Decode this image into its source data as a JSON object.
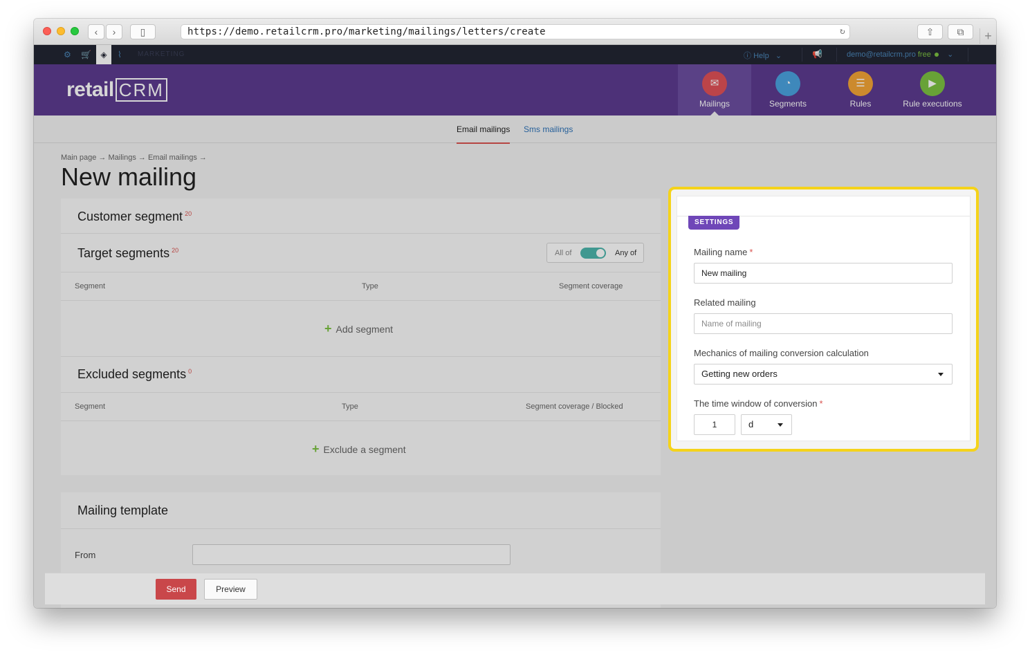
{
  "browser": {
    "url": "https://demo.retailcrm.pro/marketing/mailings/letters/create"
  },
  "topbar": {
    "section_label": "MARKETING",
    "help_label": "Help",
    "user_email": "demo@retailcrm.pro",
    "plan": "free"
  },
  "header": {
    "logo_text": "retail",
    "logo_crm": "CRM",
    "nav": [
      {
        "label": "Mailings",
        "icon": "mail-icon",
        "color": "#e05257",
        "active": true
      },
      {
        "label": "Segments",
        "icon": "segments-icon",
        "color": "#4aa3df"
      },
      {
        "label": "Rules",
        "icon": "rules-icon",
        "color": "#f3a536"
      },
      {
        "label": "Rule executions",
        "icon": "play-icon",
        "color": "#7dc242"
      }
    ]
  },
  "subtabs": {
    "email": "Email mailings",
    "sms": "Sms mailings"
  },
  "breadcrumb": "Main page → Mailings → Email mailings →",
  "page_title": "New mailing",
  "customer_segment": {
    "title": "Customer segment",
    "count": "20"
  },
  "target_segments": {
    "title": "Target segments",
    "count": "20",
    "toggle_all": "All of",
    "toggle_any": "Any of",
    "columns": [
      "Segment",
      "Type",
      "Segment coverage"
    ],
    "add_label": "Add segment"
  },
  "excluded_segments": {
    "title": "Excluded segments",
    "count": "0",
    "columns": [
      "Segment",
      "Type",
      "Segment coverage / Blocked"
    ],
    "add_label": "Exclude a segment"
  },
  "template": {
    "title": "Mailing template",
    "from_label": "From"
  },
  "footer": {
    "send": "Send",
    "preview": "Preview"
  },
  "settings": {
    "badge": "SETTINGS",
    "mailing_name_label": "Mailing name",
    "mailing_name_value": "New mailing",
    "related_label": "Related mailing",
    "related_placeholder": "Name of mailing",
    "mechanics_label": "Mechanics of mailing conversion calculation",
    "mechanics_value": "Getting new orders",
    "window_label": "The time window of conversion",
    "window_value": "1",
    "window_unit": "d",
    "required_mark": "*"
  },
  "colors": {
    "header_purple": "#5c3b8f",
    "highlight": "#f5d31a",
    "send_red": "#c9474a",
    "toggle_teal": "#4db6ac"
  }
}
